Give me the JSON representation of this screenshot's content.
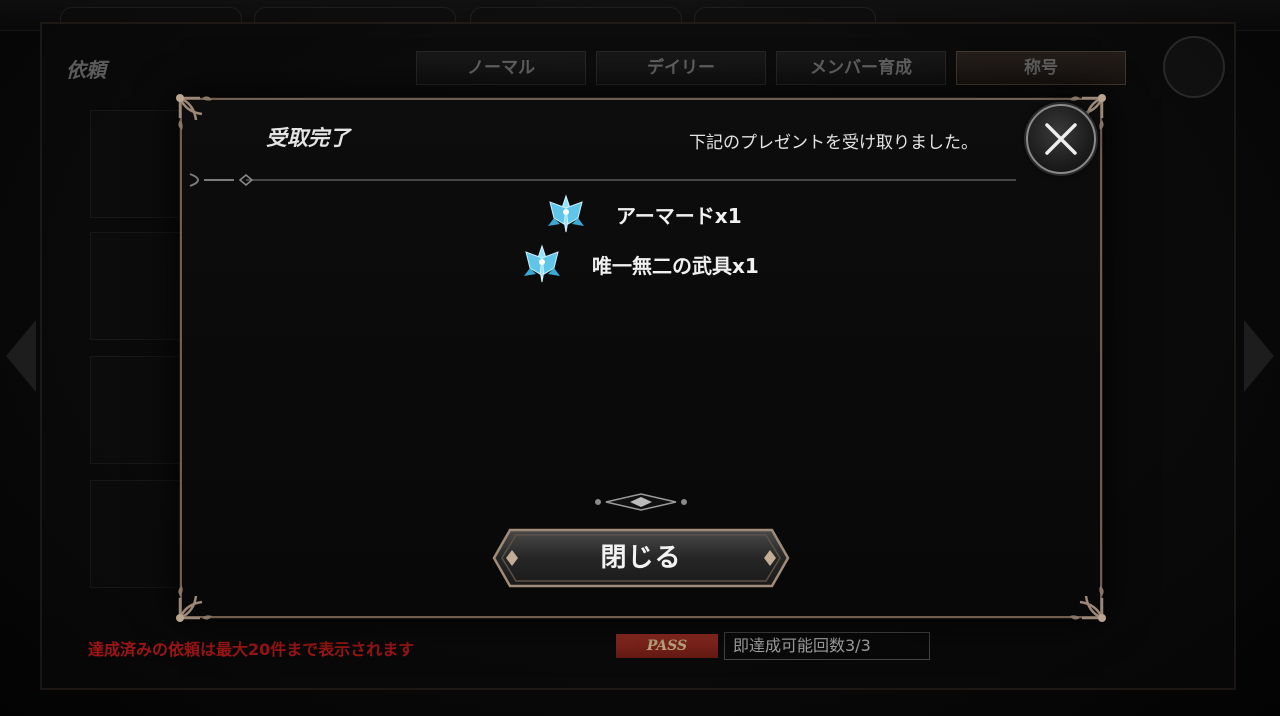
{
  "background": {
    "screen_title": "依頼",
    "tabs": [
      {
        "label": "ノーマル"
      },
      {
        "label": "デイリー"
      },
      {
        "label": "メンバー育成"
      },
      {
        "label": "称号"
      }
    ],
    "active_tab": "称号",
    "note": "達成済みの依頼は最大20件まで表示されます",
    "pass_badge": "PASS",
    "instant_clear": "即達成可能回数3/3"
  },
  "dialog": {
    "title": "受取完了",
    "message": "下記のプレゼントを受け取りました。",
    "rewards": [
      {
        "icon": "crystal-emblem-icon",
        "label": "アーマードx1"
      },
      {
        "icon": "crystal-emblem-icon",
        "label": "唯一無二の武具x1"
      }
    ],
    "close_button_label": "閉じる"
  },
  "colors": {
    "frame_bronze": "#6f5e50",
    "text_primary": "#f0f0f0",
    "note_red": "#d01a1a",
    "icon_cyan": "#8fe3ff"
  }
}
